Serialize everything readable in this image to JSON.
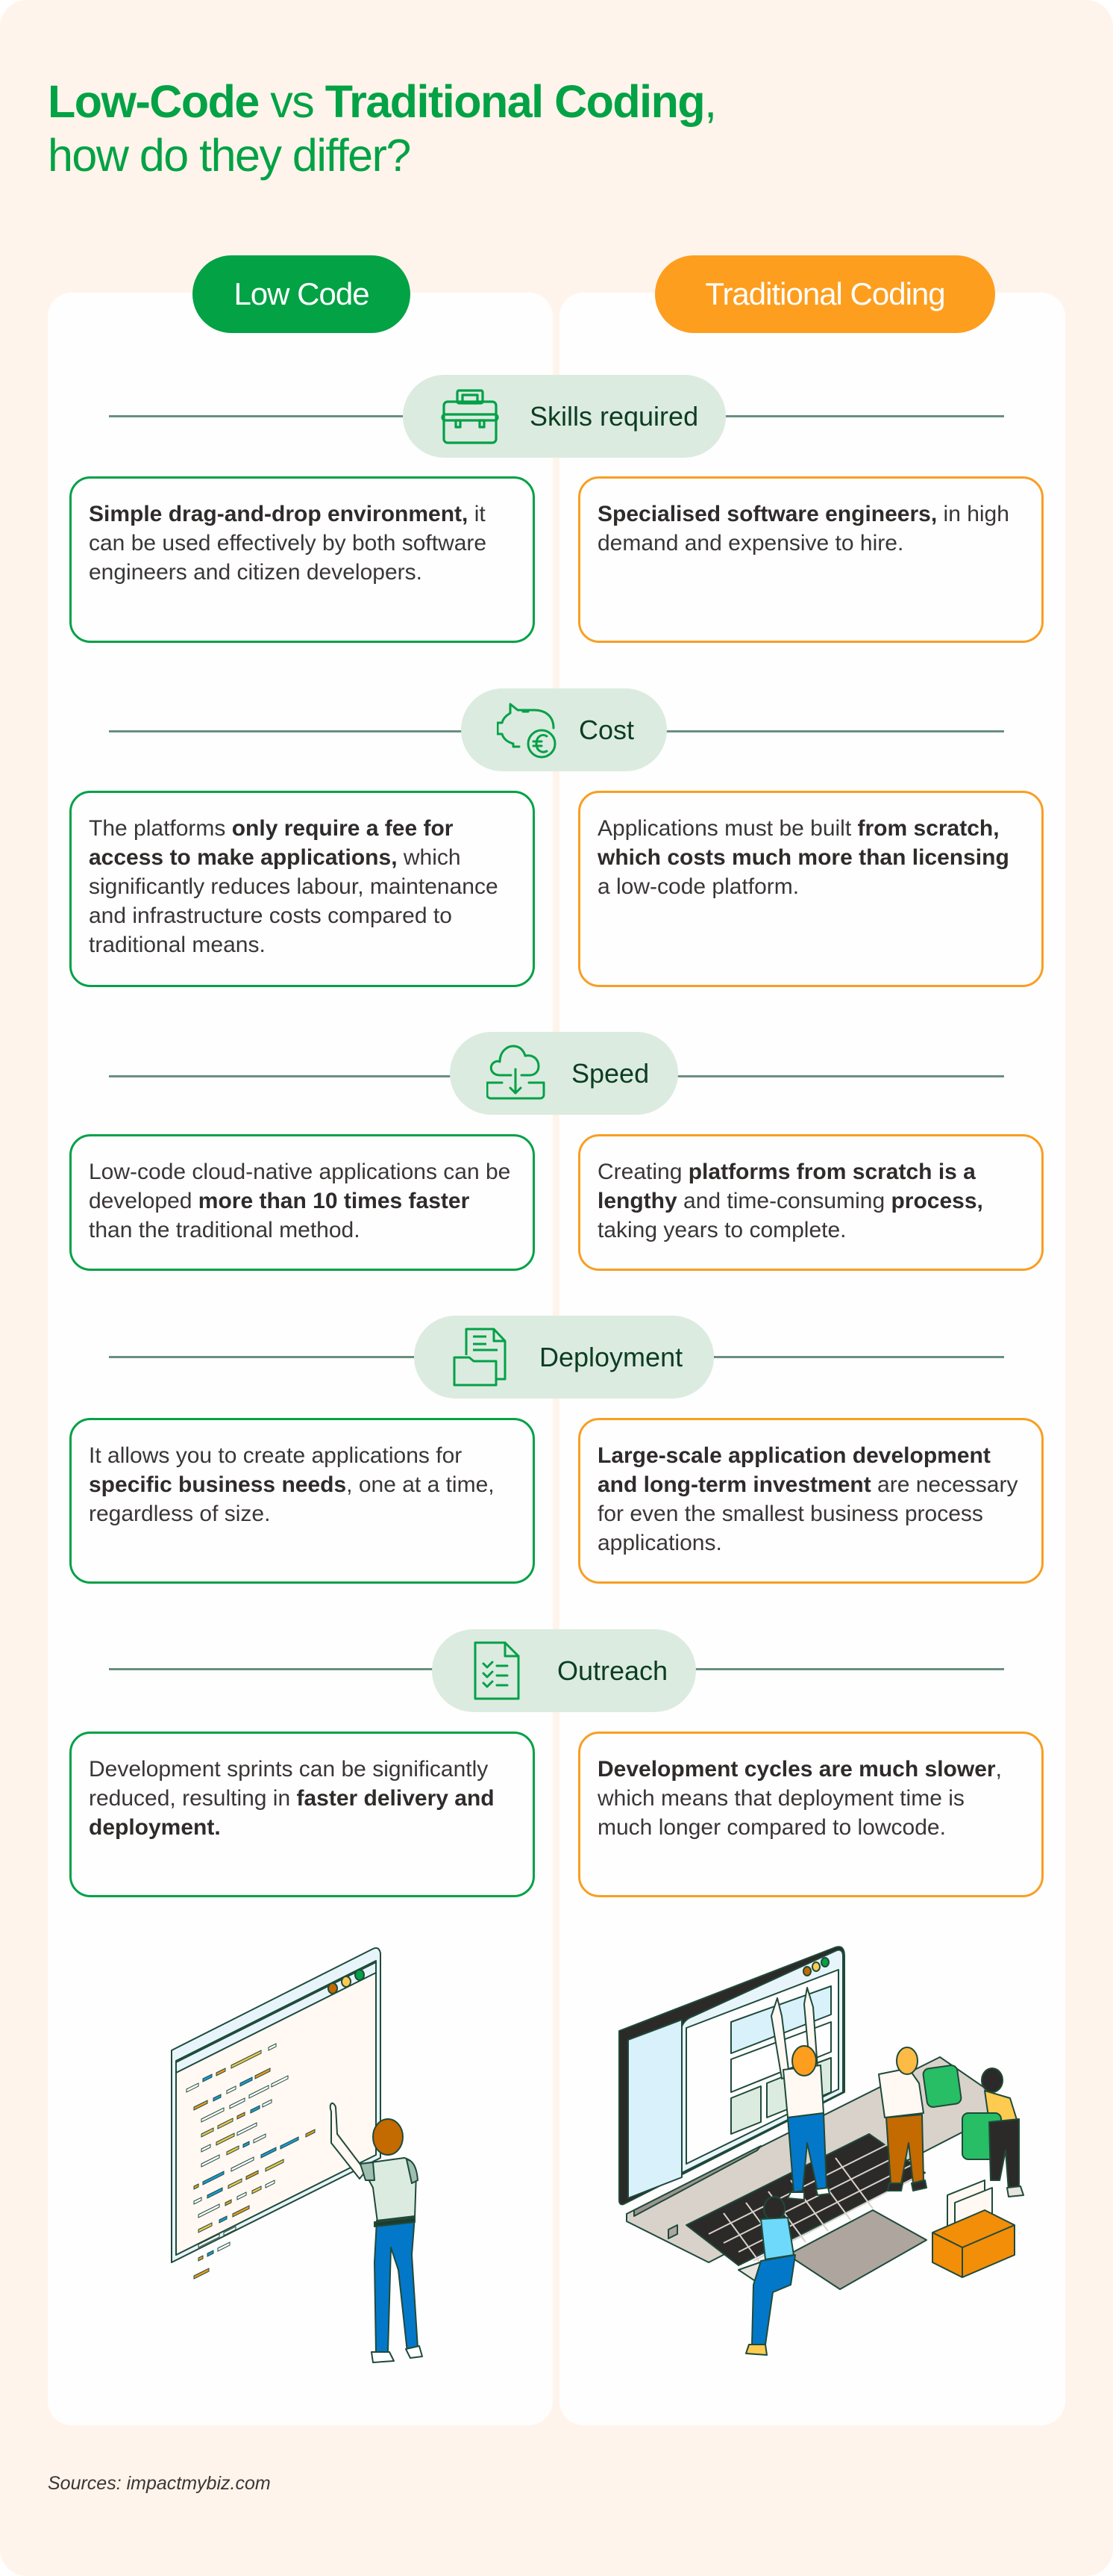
{
  "title": {
    "part1_bold": "Low-Code",
    "part2": " vs ",
    "part3_bold": "Traditional Coding",
    "part4": ",",
    "line2": "how do they differ?"
  },
  "columns": {
    "left": {
      "label": "Low Code",
      "color": "#02a245"
    },
    "right": {
      "label": "Traditional Coding",
      "color": "#fd9e1f"
    }
  },
  "sections": [
    {
      "label": "Skills required",
      "icon": "toolbox-icon",
      "low_code": [
        {
          "t": "Simple drag-and-drop environment,",
          "b": true
        },
        {
          "t": " it can be used effectively by both software engineers and citizen developers.",
          "b": false
        }
      ],
      "traditional": [
        {
          "t": "Specialised software engineers,",
          "b": true
        },
        {
          "t": " in high demand and expensive to hire.",
          "b": false
        }
      ]
    },
    {
      "label": "Cost",
      "icon": "piggy-bank-euro-icon",
      "low_code": [
        {
          "t": "The platforms ",
          "b": false
        },
        {
          "t": "only require a fee for access to make applications,",
          "b": true
        },
        {
          "t": " which significantly reduces labour, maintenance and infrastructure costs compared to traditional means.",
          "b": false
        }
      ],
      "traditional": [
        {
          "t": "Applications must be built ",
          "b": false
        },
        {
          "t": "from scratch, which costs much more than licensing",
          "b": true
        },
        {
          "t": " a low-code platform.",
          "b": false
        }
      ]
    },
    {
      "label": "Speed",
      "icon": "cloud-download-icon",
      "low_code": [
        {
          "t": "Low-code cloud-native applications can be developed ",
          "b": false
        },
        {
          "t": "more than 10 times faster",
          "b": true
        },
        {
          "t": " than the traditional method.",
          "b": false
        }
      ],
      "traditional": [
        {
          "t": "Creating ",
          "b": false
        },
        {
          "t": "platforms from scratch is a lengthy",
          "b": true
        },
        {
          "t": " and time-consuming ",
          "b": false
        },
        {
          "t": "process,",
          "b": true
        },
        {
          "t": " taking years to complete.",
          "b": false
        }
      ]
    },
    {
      "label": "Deployment",
      "icon": "folder-document-icon",
      "low_code": [
        {
          "t": "It allows you to create applications for ",
          "b": false
        },
        {
          "t": "specific business needs",
          "b": true
        },
        {
          "t": ", one at a time, regardless of size.",
          "b": false
        }
      ],
      "traditional": [
        {
          "t": "Large-scale application development and long-term investment",
          "b": true
        },
        {
          "t": " are necessary for even the smallest business process applications.",
          "b": false
        }
      ]
    },
    {
      "label": "Outreach",
      "icon": "checklist-document-icon",
      "low_code": [
        {
          "t": "Development sprints can be significantly reduced, resulting in ",
          "b": false
        },
        {
          "t": "faster delivery and deployment.",
          "b": true
        }
      ],
      "traditional": [
        {
          "t": "Development cycles are much slower",
          "b": true
        },
        {
          "t": ", which means that deployment time is much longer compared to lowcode.",
          "b": false
        }
      ]
    }
  ],
  "illustrations": {
    "left": "person-writing-code-on-screen-illustration",
    "right": "team-building-app-on-laptop-illustration",
    "code_placeholder": "{...}"
  },
  "sources": "Sources: impactmybiz.com",
  "colors": {
    "green": "#02a245",
    "orange": "#fd9e1f",
    "section_pill_bg": "#dcebe0",
    "background": "#fff4eb"
  }
}
